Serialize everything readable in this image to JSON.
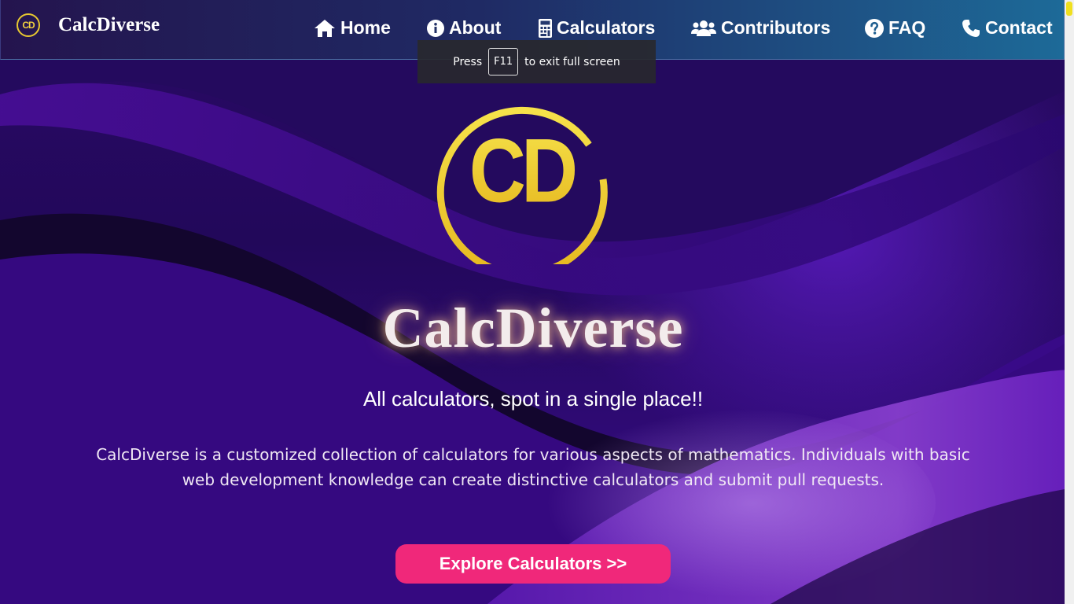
{
  "brand": {
    "logo_text": "CD",
    "name": "CalcDiverse"
  },
  "nav": {
    "items": [
      {
        "label": "Home",
        "icon": "home-icon"
      },
      {
        "label": "About",
        "icon": "info-icon"
      },
      {
        "label": "Calculators",
        "icon": "calculator-icon"
      },
      {
        "label": "Contributors",
        "icon": "users-icon"
      },
      {
        "label": "FAQ",
        "icon": "question-icon"
      },
      {
        "label": "Contact",
        "icon": "phone-icon"
      }
    ]
  },
  "fullscreen_toast": {
    "prefix": "Press",
    "key": "F11",
    "suffix": "to exit full screen"
  },
  "hero": {
    "logo_text": "CD",
    "title": "CalcDiverse",
    "tagline": "All calculators, spot in a single place!!",
    "description": "CalcDiverse is a customized collection of calculators for various aspects of mathematics. Individuals with basic web development knowledge can create distinctive calculators and submit pull requests.",
    "cta_label": "Explore Calculators >>"
  },
  "colors": {
    "accent": "#f0287a",
    "gold": "#f0d040",
    "nav_start": "#24144e",
    "nav_end": "#1d6a98"
  }
}
